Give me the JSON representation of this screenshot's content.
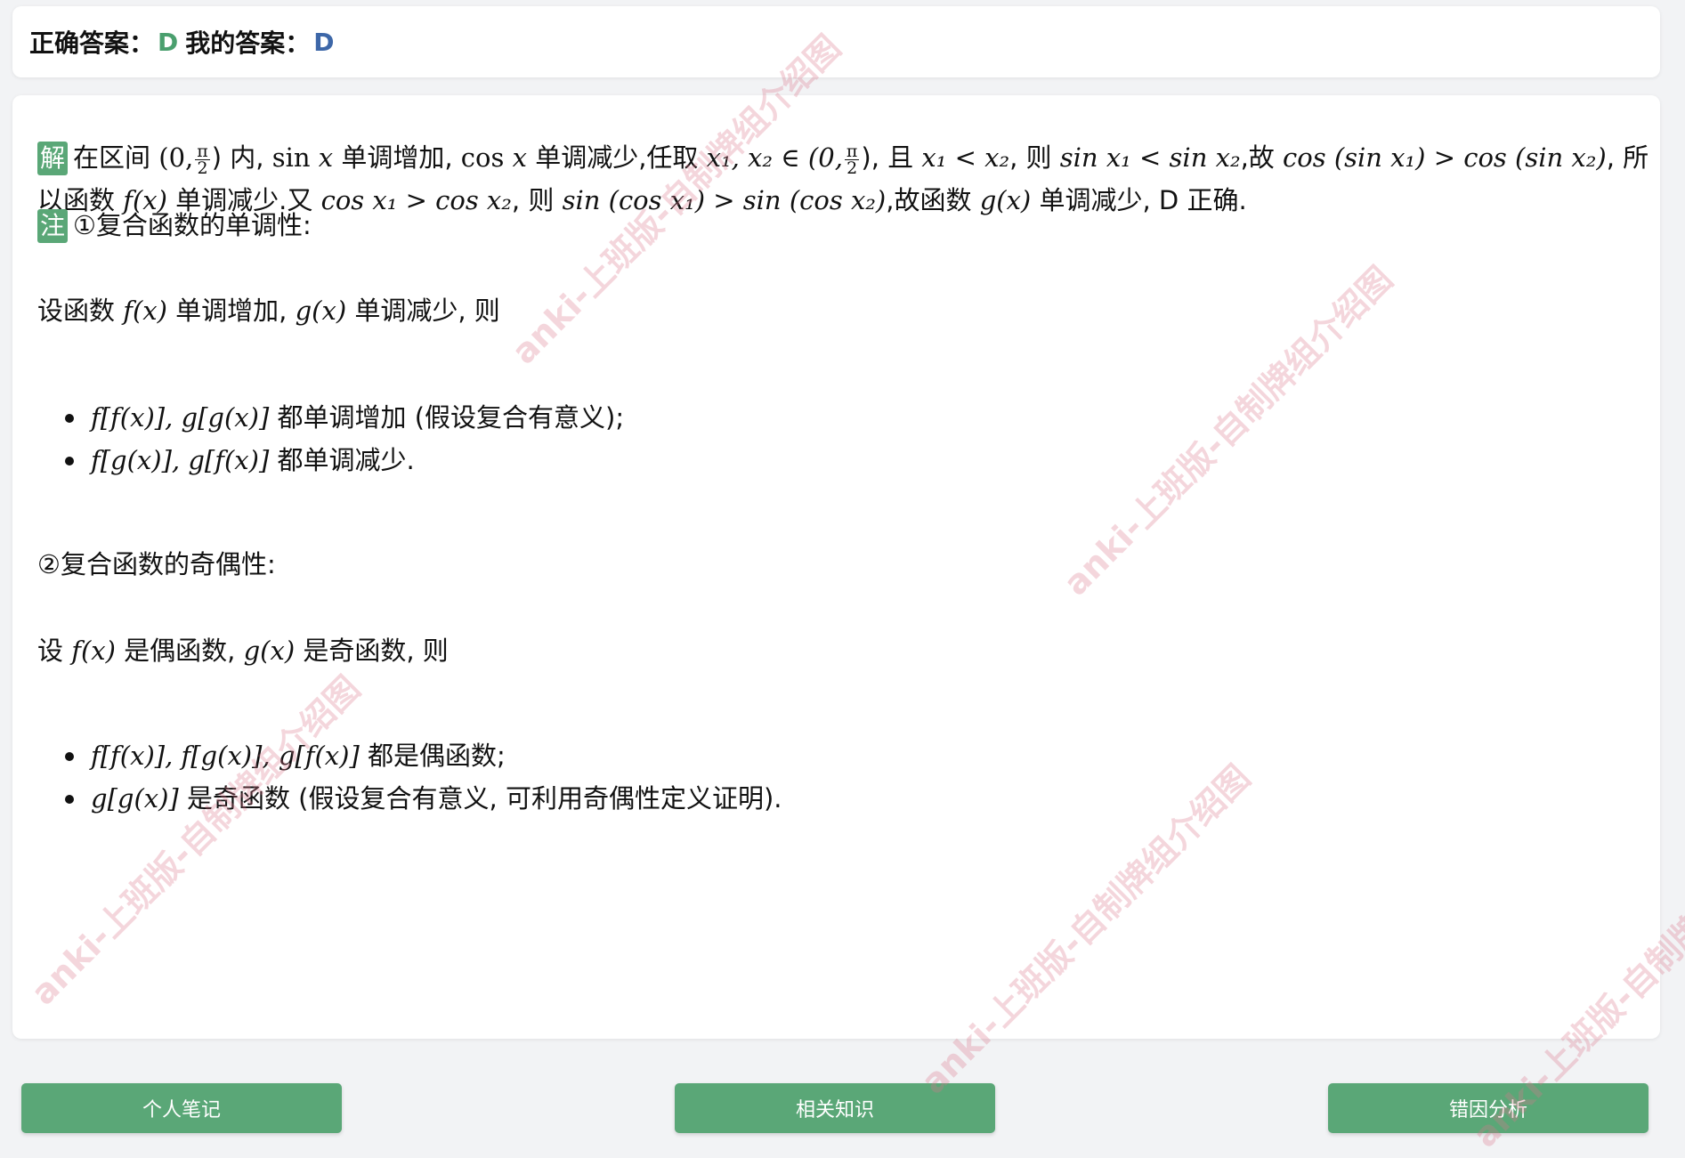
{
  "answer": {
    "correct_label": "正确答案：",
    "correct_value": "D",
    "mine_label": "我的答案：",
    "mine_value": "D"
  },
  "content": {
    "jie_tag": "解",
    "line1_a": "在区间",
    "line1_b": "(0,",
    "line1_c": ") 内,",
    "line1_d": "sin",
    "line1_e": "x",
    "line1_f": "单调增加,",
    "line1_g": "cos",
    "line1_h": "x",
    "line1_i": "单调减少,任取",
    "line1_j": "x₁, x₂ ∈ (0,",
    "line1_k": "), 且",
    "line1_l": "x₁ < x₂",
    "line1_m": ", 则",
    "line1_n": "sin x₁ < sin x₂",
    "line1_o": ",故",
    "line1_p": "cos (sin x₁) > cos (sin x₂)",
    "line1_q": ", 所",
    "frac_num": "π",
    "frac_den": "2",
    "line2_a": "以函数",
    "line2_b": "f(x)",
    "line2_c": "单调减少.又",
    "line2_d": "cos x₁ > cos x₂",
    "line2_e": ", 则",
    "line2_f": "sin (cos x₁) > sin (cos x₂)",
    "line2_g": ",故函数",
    "line2_h": "g(x)",
    "line2_i": "单调减少, D 正确.",
    "zhu_tag": "注",
    "note1": "①复合函数的单调性:",
    "mono_a": "设函数",
    "mono_b": "f(x)",
    "mono_c": "单调增加,",
    "mono_d": "g(x)",
    "mono_e": "单调减少, 则",
    "bullet1_math": "f[f(x)], g[g(x)]",
    "bullet1_text": "都单调增加 (假设复合有意义);",
    "bullet2_math": "f[g(x)], g[f(x)]",
    "bullet2_text": "都单调减少.",
    "note2": "②复合函数的奇偶性:",
    "parity_a": "设",
    "parity_b": "f(x)",
    "parity_c": "是偶函数,",
    "parity_d": "g(x)",
    "parity_e": "是奇函数, 则",
    "bullet3_math": "f[f(x)], f[g(x)], g[f(x)]",
    "bullet3_text": "都是偶函数;",
    "bullet4_math": "g[g(x)]",
    "bullet4_text": "是奇函数 (假设复合有意义, 可利用奇偶性定义证明)."
  },
  "buttons": {
    "notes": "个人笔记",
    "knowledge": "相关知识",
    "error": "错因分析"
  },
  "watermark": "anki-上班版-自制牌组介绍图",
  "colors": {
    "accent": "#5aa777",
    "correct": "#4a9f6e",
    "mine": "#3d67a8"
  }
}
